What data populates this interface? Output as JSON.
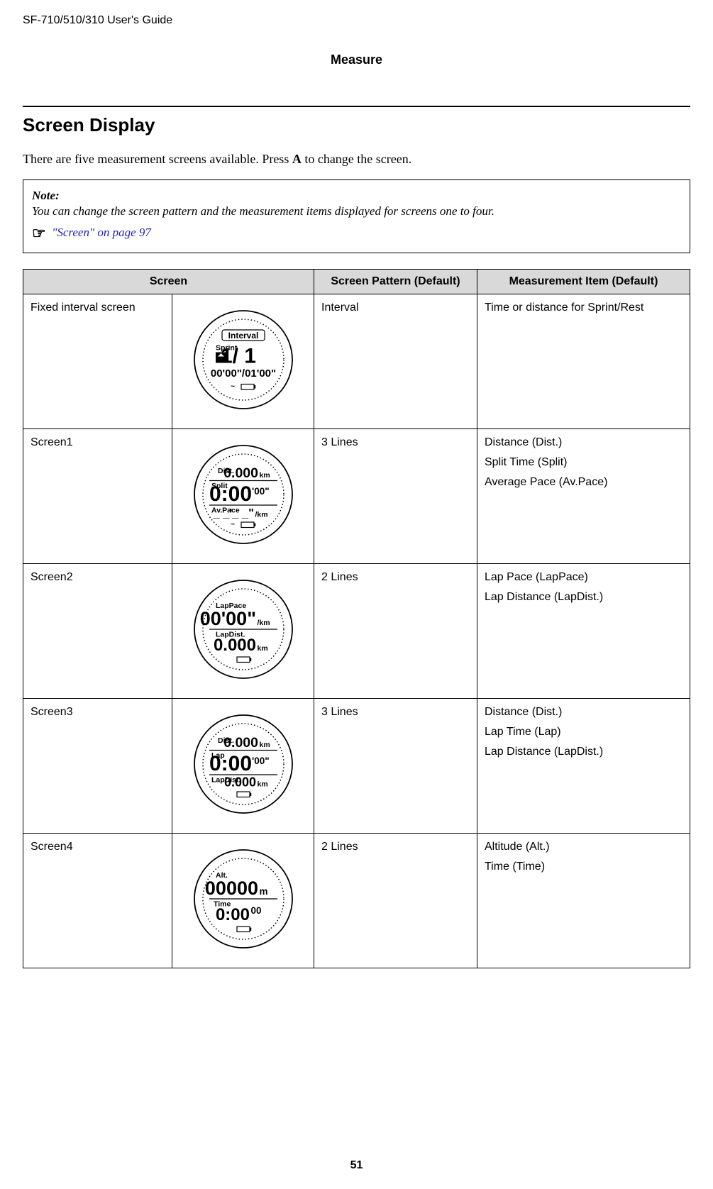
{
  "header": "SF-710/510/310     User's Guide",
  "section": "Measure",
  "heading": "Screen Display",
  "intro_before": "There are five measurement screens available. Press ",
  "intro_button": "A",
  "intro_after": " to change the screen.",
  "note": {
    "label": "Note:",
    "text": "You can change the screen pattern and the measurement items displayed for screens one to four.",
    "ref": "\"Screen\" on page 97"
  },
  "table": {
    "headers": {
      "screen": "Screen",
      "pattern": "Screen Pattern (Default)",
      "item": "Measurement Item (Default)"
    },
    "rows": [
      {
        "name": "Fixed interval screen",
        "pattern": "Interval",
        "items": [
          "Time or distance for Sprint/Rest"
        ]
      },
      {
        "name": "Screen1",
        "pattern": "3 Lines",
        "items": [
          "Distance (Dist.)",
          "Split Time (Split)",
          "Average Pace (Av.Pace)"
        ]
      },
      {
        "name": "Screen2",
        "pattern": "2 Lines",
        "items": [
          "Lap Pace (LapPace)",
          "Lap Distance (LapDist.)"
        ]
      },
      {
        "name": "Screen3",
        "pattern": "3 Lines",
        "items": [
          "Distance (Dist.)",
          "Lap Time (Lap)",
          "Lap Distance (LapDist.)"
        ]
      },
      {
        "name": "Screen4",
        "pattern": "2 Lines",
        "items": [
          "Altitude (Alt.)",
          "Time (Time)"
        ]
      }
    ]
  },
  "watch_labels": {
    "interval_title": "Interval",
    "sprint": "Sprint",
    "interval_count": "1/ 1",
    "interval_times": "00'00\"/01'00\"",
    "dist": "Dist.",
    "dist_val": "0.000",
    "km": "km",
    "split": "Split",
    "split_val": "0:00",
    "split_sec": "'00\"",
    "avpace": "Av.Pace",
    "avpace_val": "_ _'_ _\"",
    "perkm": "/km",
    "lappace": "LapPace",
    "lappace_val": "00'00\"",
    "lapdist": "LapDist.",
    "lapdist_val": "0.000",
    "lap": "Lap",
    "lap_val": "0:00",
    "lap_sec": "'00\"",
    "alt": "Alt.",
    "alt_val": "00000",
    "m": "m",
    "time": "Time",
    "time_val": "0:00",
    "time_sec": "00"
  },
  "page_number": "51"
}
